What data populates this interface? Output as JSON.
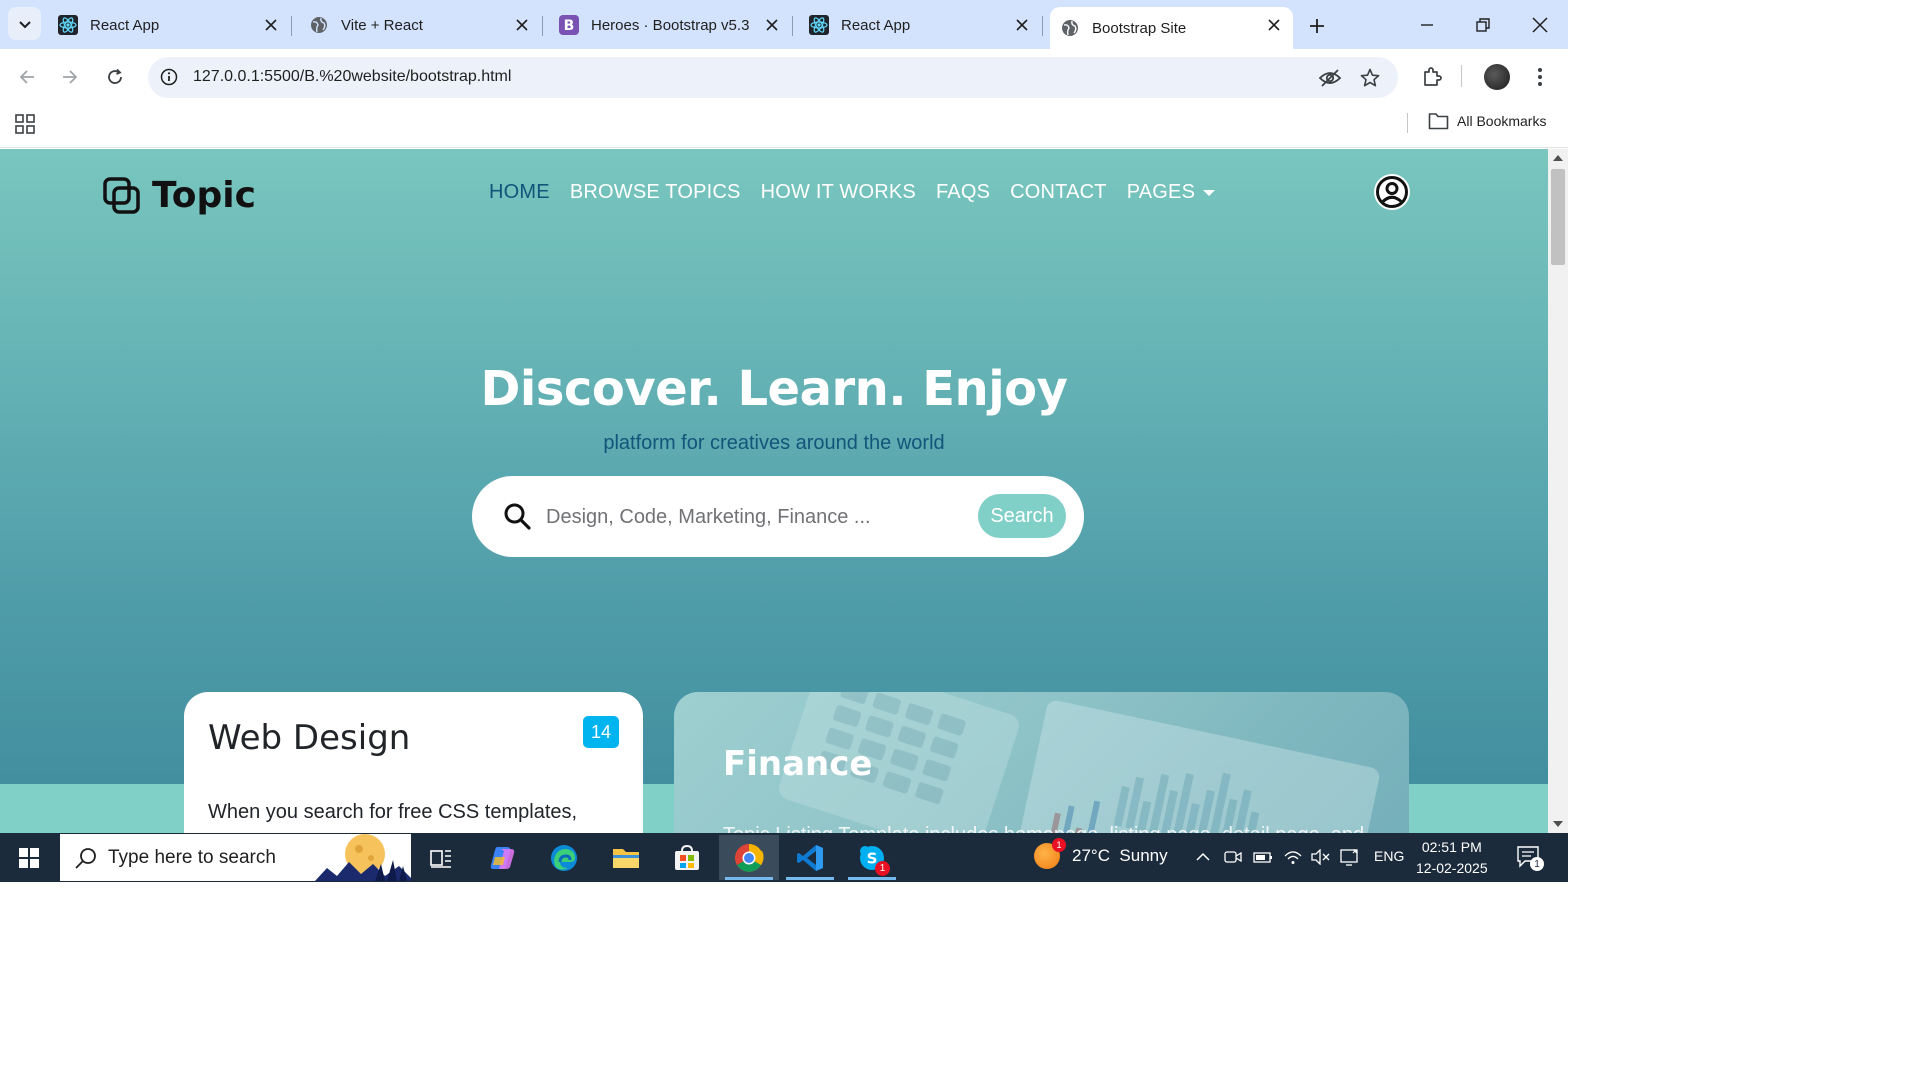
{
  "browser": {
    "tabs": [
      {
        "title": "React App",
        "favicon": "react-icon",
        "active": false
      },
      {
        "title": "Vite + React",
        "favicon": "globe-icon",
        "active": false
      },
      {
        "title": "Heroes · Bootstrap v5.3",
        "favicon": "bootstrap-icon",
        "active": false
      },
      {
        "title": "React App",
        "favicon": "react-icon",
        "active": false
      },
      {
        "title": "Bootstrap Site",
        "favicon": "globe-icon",
        "active": true
      }
    ],
    "url": "127.0.0.1:5500/B.%20website/bootstrap.html",
    "bookmarks_label": "All Bookmarks"
  },
  "page": {
    "brand": "Topic",
    "nav": [
      {
        "label": "HOME",
        "active": true
      },
      {
        "label": "BROWSE TOPICS",
        "active": false
      },
      {
        "label": "HOW IT WORKS",
        "active": false
      },
      {
        "label": "FAQS",
        "active": false
      },
      {
        "label": "CONTACT",
        "active": false
      },
      {
        "label": "PAGES",
        "active": false,
        "dropdown": true
      }
    ],
    "hero": {
      "title": "Discover. Learn. Enjoy",
      "subtitle": "platform for creatives around the world",
      "search_placeholder": "Design, Code, Marketing, Finance ...",
      "search_button": "Search"
    },
    "cards": [
      {
        "title": "Web Design",
        "badge": "14",
        "text": "When you search for free CSS templates,"
      },
      {
        "title": "Finance",
        "text": "Topic Listing Template includes homepage, listing page, detail page, and"
      }
    ],
    "colors": {
      "accent": "#80d0c7",
      "secondary": "#13547a",
      "badge": "#00b4f0"
    }
  },
  "taskbar": {
    "search_placeholder": "Type here to search",
    "weather": "27°C  Sunny",
    "weather_badge": "1",
    "language": "ENG",
    "time": "02:51 PM",
    "date": "12-02-2025",
    "skype_badge": "1",
    "notifications_badge": "1"
  }
}
